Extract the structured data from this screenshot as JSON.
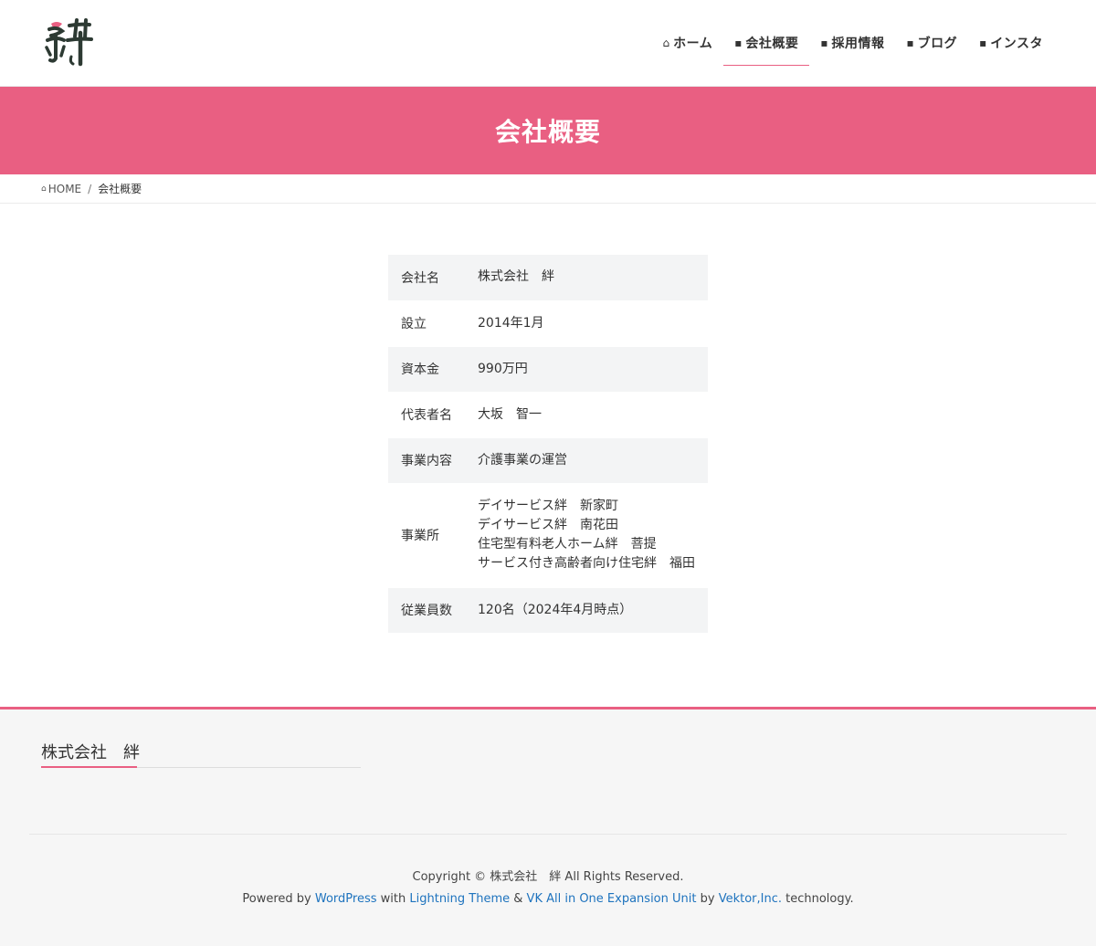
{
  "header": {
    "logo_char": "絆",
    "nav": [
      {
        "icon": "home-icon",
        "glyph": "⌂",
        "label": "ホーム"
      },
      {
        "icon": "building-icon",
        "glyph": "▪",
        "label": "会社概要",
        "active": true
      },
      {
        "icon": "briefcase-icon",
        "glyph": "▪",
        "label": "採用情報"
      },
      {
        "icon": "pen-icon",
        "glyph": "▪",
        "label": "ブログ"
      },
      {
        "icon": "instagram-icon",
        "glyph": "▪",
        "label": "インスタ"
      }
    ]
  },
  "page_title": "会社概要",
  "breadcrumb": {
    "home_label": "HOME",
    "home_icon": "home-icon",
    "separator": "/",
    "current": "会社概要"
  },
  "company_table": [
    {
      "label": "会社名",
      "value": "株式会社　絆"
    },
    {
      "label": "設立",
      "value": "2014年1月"
    },
    {
      "label": "資本金",
      "value": "990万円"
    },
    {
      "label": "代表者名",
      "value": "大坂　智一"
    },
    {
      "label": "事業内容",
      "value": "介護事業の運営"
    },
    {
      "label": "事業所",
      "lines": [
        "デイサービス絆　新家町",
        "デイサービス絆　南花田",
        "住宅型有料老人ホーム絆　菩提",
        "サービス付き高齢者向け住宅絆　福田"
      ]
    },
    {
      "label": "従業員数",
      "value": "120名（2024年4月時点）"
    }
  ],
  "footer": {
    "company_name": "株式会社　絆",
    "copyright": "Copyright © 株式会社　絆 All Rights Reserved.",
    "powered": {
      "prefix": "Powered by ",
      "wordpress": "WordPress",
      "with": " with ",
      "theme": "Lightning Theme",
      "amp": " & ",
      "vk": "VK All in One Expansion Unit",
      "by": " by ",
      "vektor": "Vektor,Inc.",
      "suffix": " technology."
    }
  },
  "colors": {
    "accent": "#e95f82",
    "link": "#1e73be",
    "row_bg": "#f3f4f5"
  }
}
